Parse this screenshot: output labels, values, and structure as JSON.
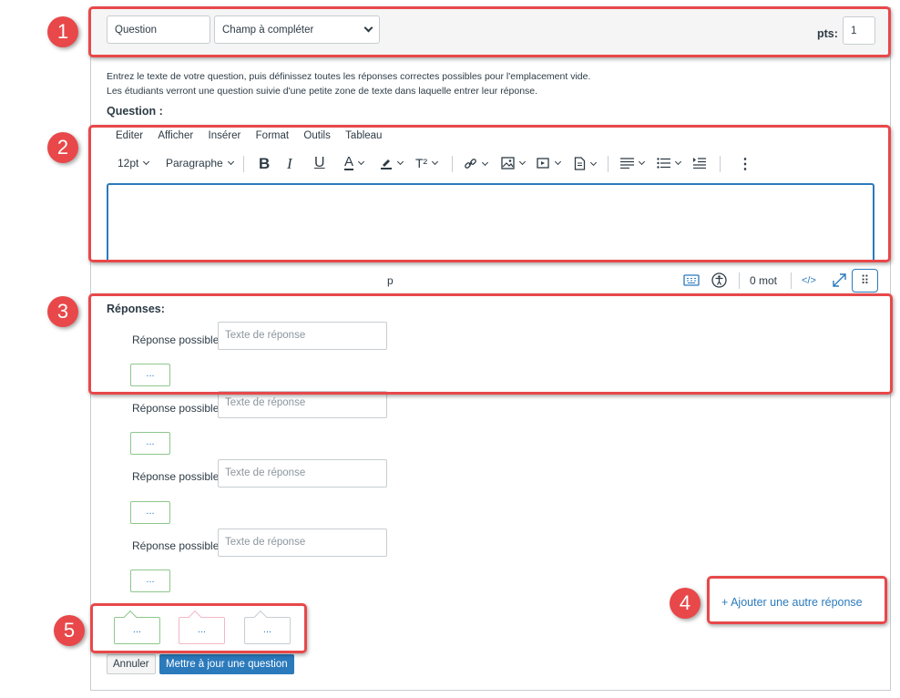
{
  "header": {
    "question_name": "Question",
    "question_type": "Champ à compléter",
    "pts_label": "pts:",
    "pts_value": "1"
  },
  "instructions": {
    "line1": "Entrez le texte de votre question, puis définissez toutes les réponses correctes possibles pour l'emplacement vide.",
    "line2": "Les étudiants verront une question suivie d'une petite zone de texte dans laquelle entrer leur réponse."
  },
  "question_label": "Question :",
  "editor": {
    "menu": [
      "Editer",
      "Afficher",
      "Insérer",
      "Format",
      "Outils",
      "Tableau"
    ],
    "font_size": "12pt",
    "paragraph": "Paragraphe",
    "bold": "B",
    "italic": "I",
    "underline": "U",
    "text_color": "A",
    "superscript": "T²",
    "status_element": "p",
    "word_count": "0 mot",
    "html_toggle": "</>",
    "more_dots": "⋮",
    "drag_dots": "⠿"
  },
  "answers": {
    "title": "Réponses:",
    "label": "Réponse possible:",
    "placeholder": "Texte de réponse",
    "comment_dots": "...",
    "add_answer": "+ Ajouter une autre réponse"
  },
  "general_comments": {
    "correct": "...",
    "incorrect": "...",
    "neutral": "..."
  },
  "buttons": {
    "cancel": "Annuler",
    "update": "Mettre à jour une question"
  },
  "callouts": [
    "1",
    "2",
    "3",
    "4",
    "5"
  ],
  "colors": {
    "accent": "#2b7abc",
    "highlight": "#e8484a",
    "correct_border": "#8dc78d",
    "incorrect_border": "#f2b8c6"
  }
}
